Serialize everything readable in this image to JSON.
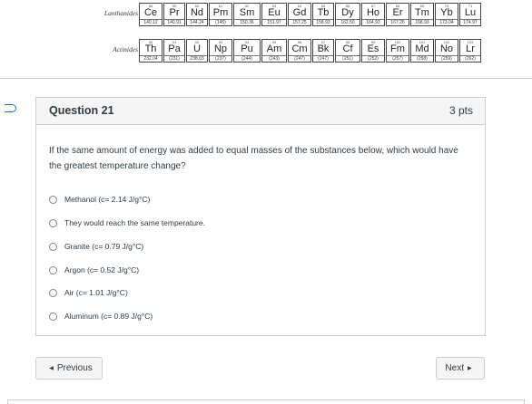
{
  "periodic_table": {
    "lanthanides": {
      "label": "Lanthanides",
      "elements": [
        {
          "num": "58",
          "sym": "Ce",
          "mass": "140.12"
        },
        {
          "num": "59",
          "sym": "Pr",
          "mass": "140.91"
        },
        {
          "num": "60",
          "sym": "Nd",
          "mass": "144.24"
        },
        {
          "num": "61",
          "sym": "Pm",
          "mass": "(145)"
        },
        {
          "num": "62",
          "sym": "Sm",
          "mass": "150.36"
        },
        {
          "num": "63",
          "sym": "Eu",
          "mass": "151.97"
        },
        {
          "num": "64",
          "sym": "Gd",
          "mass": "157.25"
        },
        {
          "num": "65",
          "sym": "Tb",
          "mass": "158.93"
        },
        {
          "num": "66",
          "sym": "Dy",
          "mass": "162.50"
        },
        {
          "num": "67",
          "sym": "Ho",
          "mass": "164.93"
        },
        {
          "num": "68",
          "sym": "Er",
          "mass": "167.26"
        },
        {
          "num": "69",
          "sym": "Tm",
          "mass": "168.93"
        },
        {
          "num": "70",
          "sym": "Yb",
          "mass": "173.04"
        },
        {
          "num": "71",
          "sym": "Lu",
          "mass": "174.97"
        }
      ]
    },
    "actinides": {
      "label": "Actinides",
      "elements": [
        {
          "num": "90",
          "sym": "Th",
          "mass": "232.04"
        },
        {
          "num": "91",
          "sym": "Pa",
          "mass": "(231)"
        },
        {
          "num": "92",
          "sym": "U",
          "mass": "238.03"
        },
        {
          "num": "93",
          "sym": "Np",
          "mass": "(237)"
        },
        {
          "num": "94",
          "sym": "Pu",
          "mass": "(244)"
        },
        {
          "num": "95",
          "sym": "Am",
          "mass": "(243)"
        },
        {
          "num": "96",
          "sym": "Cm",
          "mass": "(247)"
        },
        {
          "num": "97",
          "sym": "Bk",
          "mass": "(247)"
        },
        {
          "num": "98",
          "sym": "Cf",
          "mass": "(251)"
        },
        {
          "num": "99",
          "sym": "Es",
          "mass": "(252)"
        },
        {
          "num": "100",
          "sym": "Fm",
          "mass": "(257)"
        },
        {
          "num": "101",
          "sym": "Md",
          "mass": "(258)"
        },
        {
          "num": "102",
          "sym": "No",
          "mass": "(259)"
        },
        {
          "num": "103",
          "sym": "Lr",
          "mass": "(262)"
        }
      ]
    }
  },
  "question": {
    "title": "Question 21",
    "points": "3 pts",
    "text": "If the same amount of energy was added to equal masses of the substances below, which would have the greatest temperature change?",
    "answers": [
      "Methanol (c= 2.14 J/g°C)",
      "They would reach the same temperature.",
      "Granite (c= 0.79 J/g°C)",
      "Argon (c= 0.52 J/g°C)",
      "Air (c= 1.01 J/g°C)",
      "Aluminum (c= 0.89 J/g°C)"
    ]
  },
  "nav": {
    "previous_label": "Previous",
    "next_label": "Next"
  },
  "colors": {
    "accent": "#1a73c7",
    "border": "#c7cdd1",
    "text": "#2d3b45",
    "header_bg": "#f5f5f5"
  }
}
